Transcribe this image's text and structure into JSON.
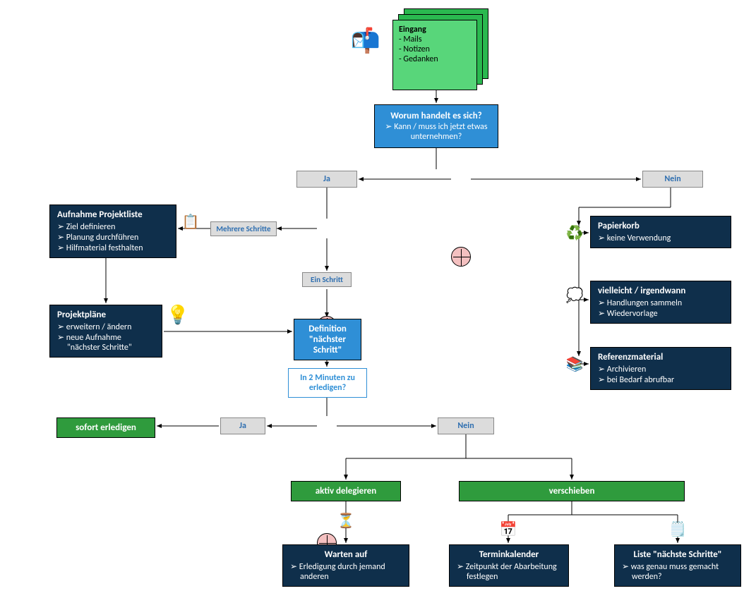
{
  "eingang": {
    "title": "Eingang",
    "items": [
      "- Mails",
      "- Notizen",
      "- Gedanken"
    ]
  },
  "worum": {
    "title": "Worum handelt es sich?",
    "sub": "Kann / muss ich jetzt etwas unternehmen?"
  },
  "ja": "Ja",
  "nein": "Nein",
  "mehrere": "Mehrere Schritte",
  "einschritt": "Ein Schritt",
  "definition_title": "Definition",
  "definition_sub": "\"nächster Schritt\"",
  "in2min": "In 2 Minuten zu erledigen?",
  "sofort": "sofort erledigen",
  "delegieren": "aktiv delegieren",
  "verschieben": "verschieben",
  "aufnahme": {
    "title": "Aufnahme Projektliste",
    "items": [
      "Ziel definieren",
      "Planung durchführen",
      "Hilfmaterial festhalten"
    ]
  },
  "projektplaene": {
    "title": "Projektpläne",
    "items": [
      "erweitern / ändern",
      "neue Aufnahme \"nächster Schritte\""
    ]
  },
  "papierkorb": {
    "title": "Papierkorb",
    "items": [
      "keine Verwendung"
    ]
  },
  "vielleicht": {
    "title": "vielleicht / irgendwann",
    "items": [
      "Handlungen sammeln",
      "Wiedervorlage"
    ]
  },
  "referenz": {
    "title": "Referenzmaterial",
    "items": [
      "Archivieren",
      "bei Bedarf abrufbar"
    ]
  },
  "warten": {
    "title": "Warten auf",
    "items": [
      "Erledigung durch jemand anderen"
    ]
  },
  "termin": {
    "title": "Terminkalender",
    "items": [
      "Zeitpunkt der Abarbeitung festlegen"
    ]
  },
  "liste": {
    "title": "Liste \"nächste Schritte\"",
    "items": [
      "was genau muss gemacht werden?"
    ]
  },
  "icons": {
    "mailbox": "📬",
    "clipboard": "📋",
    "idea": "💡",
    "recycle": "♻️",
    "thought": "💭",
    "binders": "📚",
    "hourglass": "⏳",
    "calendar": "📅",
    "checklist": "🗒️"
  }
}
